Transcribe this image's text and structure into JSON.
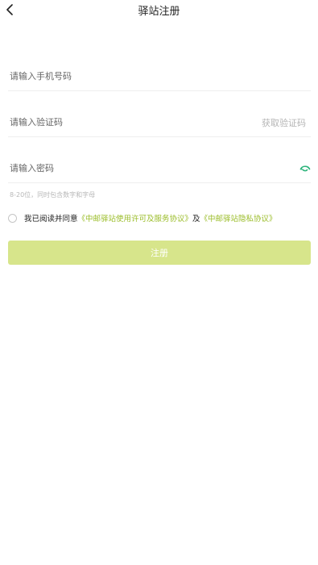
{
  "header": {
    "title": "驿站注册",
    "back_icon": "chevron-left-icon"
  },
  "form": {
    "phone_placeholder": "请输入手机号码",
    "code_placeholder": "请输入验证码",
    "get_code_label": "获取验证码",
    "password_placeholder": "请输入密码",
    "password_toggle_icon": "eye-toggle-icon",
    "password_hint": "8-20位，同时包含数字和字母"
  },
  "agreement": {
    "text_prefix": "我已阅读并同意",
    "link_service": "《中邮驿站使用许可及服务协议》",
    "text_and": "及",
    "link_privacy": "《中邮驿站隐私协议》"
  },
  "submit_label": "注册",
  "colors": {
    "accent": "#9bbd2a",
    "button_disabled": "#d7e58b",
    "eye_icon": "#2bb37a"
  }
}
